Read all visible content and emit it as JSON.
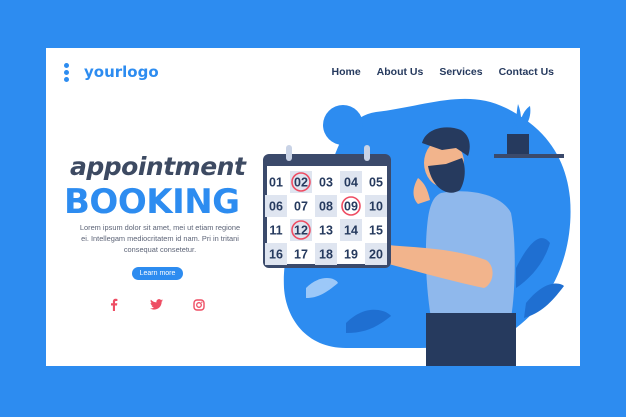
{
  "header": {
    "logo_text": "yourlogo",
    "nav": [
      "Home",
      "About Us",
      "Services",
      "Contact Us"
    ]
  },
  "hero": {
    "title_line1": "appointment",
    "title_line2": "BOOKING",
    "body_lines": [
      "Lorem ipsum dolor sit amet, mei ut etiam regione",
      "ei. Intellegam mediocritatem id nam. Pri in tritani",
      "consequat consetetur."
    ],
    "button_label": "Learn more"
  },
  "social": {
    "icons": [
      "facebook-icon",
      "twitter-icon",
      "instagram-icon"
    ],
    "color": "#ee4d63"
  },
  "calendar": {
    "rows": [
      [
        "01",
        "02",
        "03",
        "04",
        "05"
      ],
      [
        "06",
        "07",
        "08",
        "09",
        "10"
      ],
      [
        "11",
        "12",
        "13",
        "14",
        "15"
      ],
      [
        "16",
        "17",
        "18",
        "19",
        "20"
      ]
    ],
    "circled": [
      "02",
      "09",
      "12"
    ]
  },
  "colors": {
    "brand": "#2d8cf0",
    "text_dark": "#3d4a62",
    "accent_red": "#ee4d63",
    "calendar_frame": "#3b4a6b"
  }
}
